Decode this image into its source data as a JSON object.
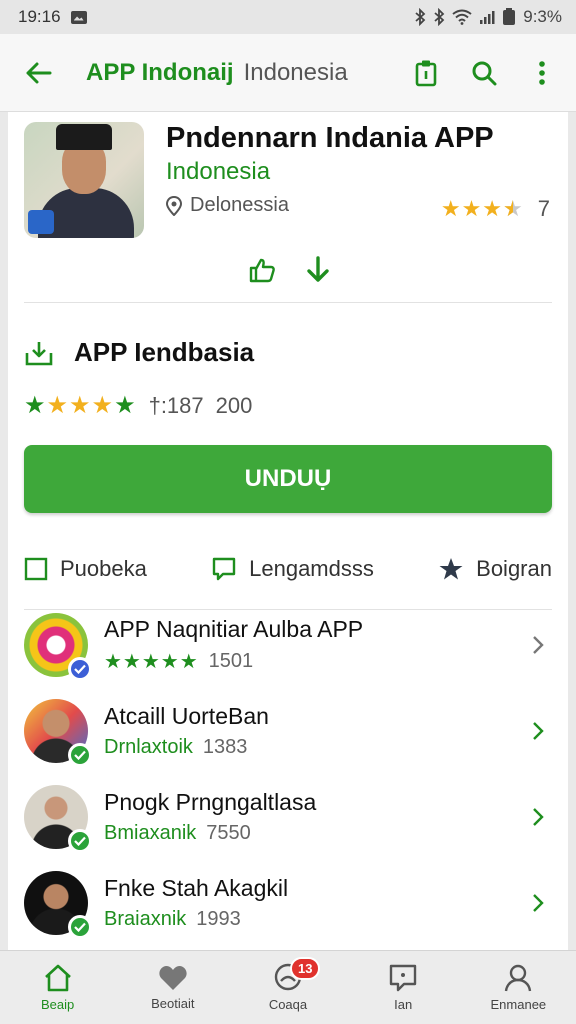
{
  "status_bar": {
    "time": "19:16",
    "battery": "9:3%"
  },
  "app_bar": {
    "title": "APP Indonaij",
    "subtitle": "Indonesia"
  },
  "header": {
    "title": "Pndennarn Indania APP",
    "country": "Indonesia",
    "location": "Delonessia",
    "rating_stars": 3.5,
    "rating_value": "7"
  },
  "section": {
    "title": "APP Iendbasia",
    "rating_text": "†:187",
    "count": "200",
    "download_label": "UNDUỤ"
  },
  "tabs": [
    {
      "label": "Puobeka",
      "icon": "square-icon"
    },
    {
      "label": "Lengamdsss",
      "icon": "comment-icon"
    },
    {
      "label": "Boigran",
      "icon": "star-icon"
    }
  ],
  "list": [
    {
      "title": "APP Naqnitiar Aulba APP",
      "sub_label": "",
      "sub_count": "1501",
      "icon": "app-logo-icon"
    },
    {
      "title": "Atcaill UorteBan",
      "sub_label": "Drnlaxtoik",
      "sub_count": "1383",
      "icon": "avatar"
    },
    {
      "title": "Pnogk Prngngaltlasa",
      "sub_label": "Bmiaxanik",
      "sub_count": "7550",
      "icon": "avatar"
    },
    {
      "title": "Fnke Stah Akagkil",
      "sub_label": "Braiaxnik",
      "sub_count": "1993",
      "icon": "avatar"
    }
  ],
  "bottom_nav": [
    {
      "label": "Beaip",
      "icon": "home-icon",
      "active": true
    },
    {
      "label": "Beotiait",
      "icon": "heart-icon"
    },
    {
      "label": "Coaqa",
      "icon": "chat-bubble-icon",
      "badge": "13"
    },
    {
      "label": "Ian",
      "icon": "message-icon"
    },
    {
      "label": "Enmanee",
      "icon": "profile-icon"
    }
  ],
  "colors": {
    "accent": "#1e8e1e",
    "button": "#3ea83a",
    "star": "#f2b01e",
    "badge": "#e0322d"
  }
}
